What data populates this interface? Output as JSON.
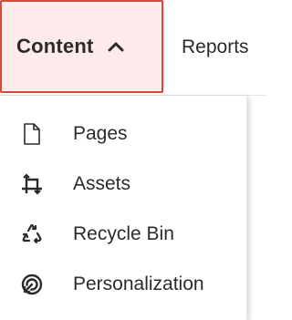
{
  "nav": {
    "tabs": [
      {
        "label": "Content",
        "expanded": true
      },
      {
        "label": "Reports"
      }
    ]
  },
  "menu": {
    "items": [
      {
        "label": "Pages",
        "icon": "page-icon"
      },
      {
        "label": "Assets",
        "icon": "assets-icon"
      },
      {
        "label": "Recycle Bin",
        "icon": "recycle-icon"
      },
      {
        "label": "Personalization",
        "icon": "personalization-icon"
      }
    ]
  },
  "colors": {
    "active_tab_bg": "#fcebea",
    "active_tab_border": "#d44b3c",
    "text": "#2b2b2b"
  }
}
